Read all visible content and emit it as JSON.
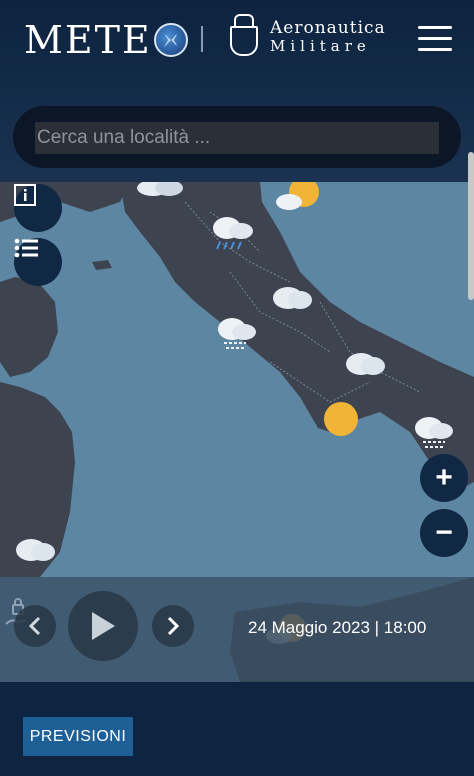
{
  "header": {
    "logo_meteo": "METE",
    "logo_am_line1": "Aeronautica",
    "logo_am_line2": "Militare"
  },
  "search": {
    "placeholder": "Cerca una località ...",
    "value": ""
  },
  "map": {
    "sea_color": "#5d86a3",
    "land_color": "#3e4350",
    "buttons": [
      "info-icon",
      "list-icon"
    ],
    "zoom": [
      "+",
      "−"
    ]
  },
  "timeline": {
    "datetime": "24 Maggio 2023 | 18:00",
    "controls": [
      "chevron-left-icon",
      "play-icon",
      "chevron-right-icon"
    ]
  },
  "footer": {
    "previsioni_label": "PREVISIONI"
  },
  "colors": {
    "header_bg": "#0f2440",
    "accent_button": "#1e5f96",
    "sun": "#f0b436"
  }
}
